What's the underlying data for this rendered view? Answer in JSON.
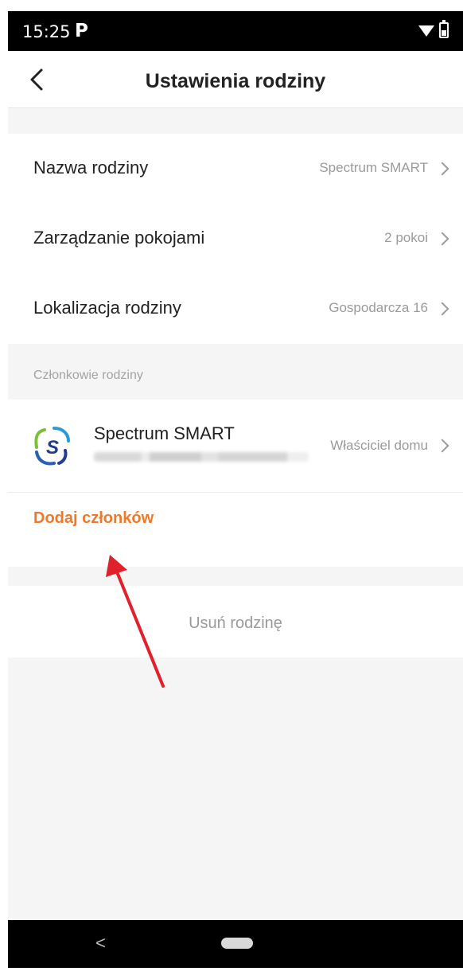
{
  "status_bar": {
    "time": "15:25",
    "notification_icon": "P"
  },
  "header": {
    "title": "Ustawienia rodziny"
  },
  "settings": [
    {
      "label": "Nazwa rodziny",
      "value": "Spectrum SMART"
    },
    {
      "label": "Zarządzanie pokojami",
      "value": "2 pokoi"
    },
    {
      "label": "Lokalizacja rodziny",
      "value": "Gospodarcza 16"
    }
  ],
  "members_section": {
    "header": "Członkowie rodziny",
    "members": [
      {
        "name": "Spectrum SMART",
        "role": "Właściciel domu"
      }
    ],
    "add_label": "Dodaj członków"
  },
  "delete_label": "Usuń rodzinę",
  "nav": {
    "back_glyph": "<"
  },
  "colors": {
    "accent": "#ec7a2c",
    "annotation": "#e0212b"
  }
}
